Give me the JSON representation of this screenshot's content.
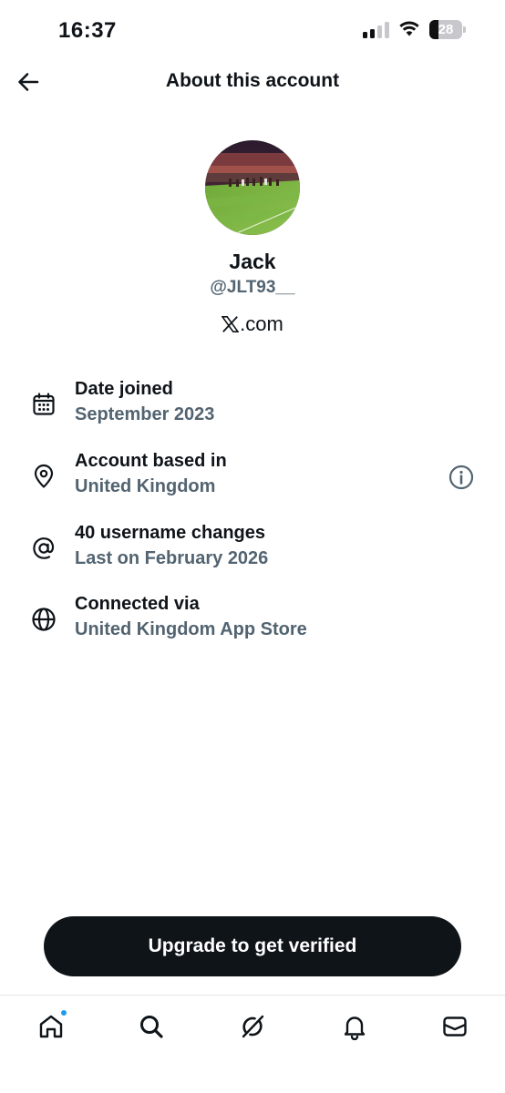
{
  "status_bar": {
    "time": "16:37",
    "battery_level": "28",
    "battery_percent": 28,
    "signal_bars_active": 2,
    "signal_bars_total": 4,
    "icons": [
      "signal-icon",
      "wifi-icon",
      "battery-icon"
    ]
  },
  "header": {
    "title": "About this account",
    "back_icon": "arrow-left-icon"
  },
  "profile": {
    "name": "Jack",
    "handle": "@JLT93__",
    "site_text": ".com",
    "site_logo_icon": "x-logo-icon",
    "avatar_description": "stadium-pitch-photo"
  },
  "info_rows": [
    {
      "icon": "calendar-icon",
      "title": "Date joined",
      "value": "September 2023"
    },
    {
      "icon": "location-pin-icon",
      "title": "Account based in",
      "value": "United Kingdom",
      "action_icon": "info-icon"
    },
    {
      "icon": "at-sign-icon",
      "title": "40 username changes",
      "value": "Last on February 2026"
    },
    {
      "icon": "globe-icon",
      "title": "Connected via",
      "value": "United Kingdom App Store"
    }
  ],
  "cta": {
    "label": "Upgrade to get verified"
  },
  "tab_bar": {
    "tabs": [
      {
        "name": "home",
        "icon": "home-icon",
        "badge": true
      },
      {
        "name": "search",
        "icon": "search-icon",
        "badge": false
      },
      {
        "name": "grok",
        "icon": "grok-icon",
        "badge": false
      },
      {
        "name": "notifications",
        "icon": "bell-icon",
        "badge": false
      },
      {
        "name": "messages",
        "icon": "mail-icon",
        "badge": false
      }
    ]
  },
  "colors": {
    "text_primary": "#0f1419",
    "text_secondary": "#536471",
    "cta_background": "#0f1419",
    "badge_blue": "#1d9bf0"
  }
}
